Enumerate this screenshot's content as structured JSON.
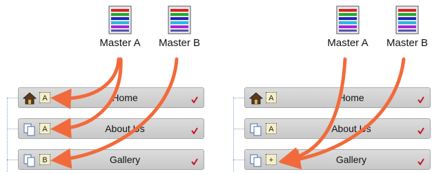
{
  "colors": {
    "arrow": "#f26a3b",
    "check": "#c8102e",
    "row_bg": "#cfcfcf"
  },
  "panels": [
    {
      "masters": [
        {
          "label": "Master A"
        },
        {
          "label": "Master B"
        }
      ],
      "pages": [
        {
          "label": "Home",
          "icon": "home-icon",
          "badge": "A"
        },
        {
          "label": "About Us",
          "icon": "pages-icon",
          "badge": "A"
        },
        {
          "label": "Gallery",
          "icon": "pages-icon",
          "badge": "B"
        }
      ]
    },
    {
      "masters": [
        {
          "label": "Master A"
        },
        {
          "label": "Master B"
        }
      ],
      "pages": [
        {
          "label": "Home",
          "icon": "home-icon",
          "badge": "A"
        },
        {
          "label": "About Us",
          "icon": "pages-icon",
          "badge": "A"
        },
        {
          "label": "Gallery",
          "icon": "pages-icon",
          "badge": "+"
        }
      ]
    }
  ]
}
